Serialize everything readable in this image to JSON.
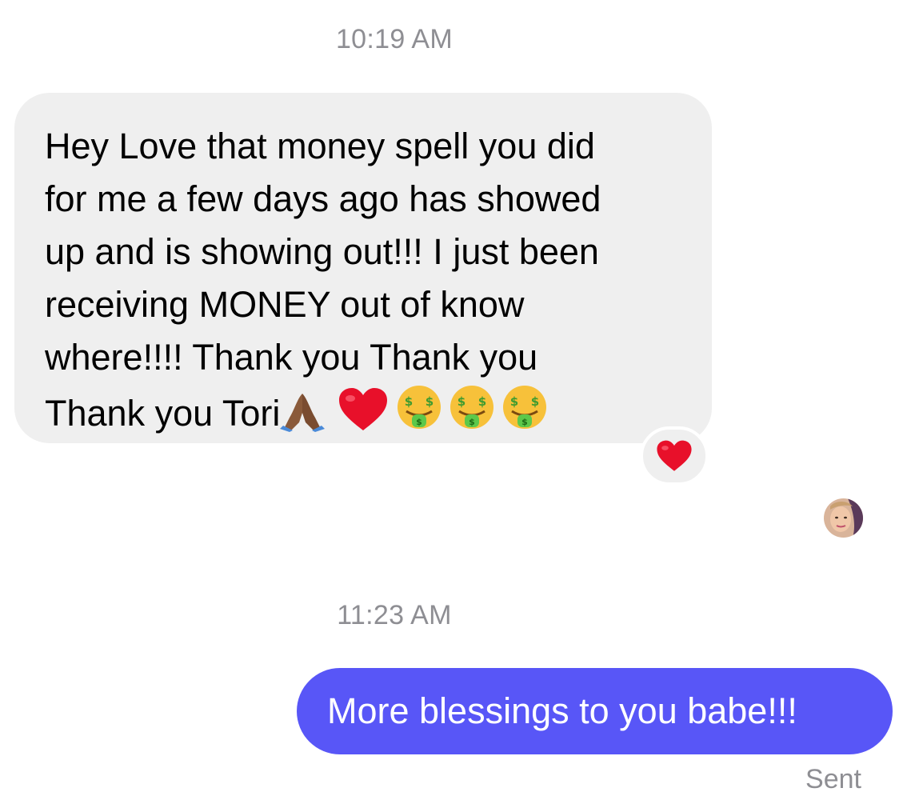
{
  "conversation": {
    "messages": [
      {
        "timestamp": "10:19 AM",
        "text_lines": [
          "Hey Love that money spell you did",
          "for me a few days ago has showed",
          "up and is showing out!!! I just been",
          "receiving MONEY out of know",
          "where!!!! Thank you Thank you",
          "Thank you Tori"
        ],
        "trailing_emojis": [
          "folded-hands-icon",
          "red-heart-icon",
          "money-mouth-face-icon",
          "money-mouth-face-icon",
          "money-mouth-face-icon"
        ],
        "reaction": "red-heart-icon"
      },
      {
        "timestamp": "11:23 AM",
        "text": "More blessings to you babe!!!",
        "status": "Sent"
      }
    ]
  },
  "colors": {
    "incoming_bubble": "#efefef",
    "outgoing_bubble": "#5856f7",
    "timestamp_text": "#8e8e93"
  }
}
